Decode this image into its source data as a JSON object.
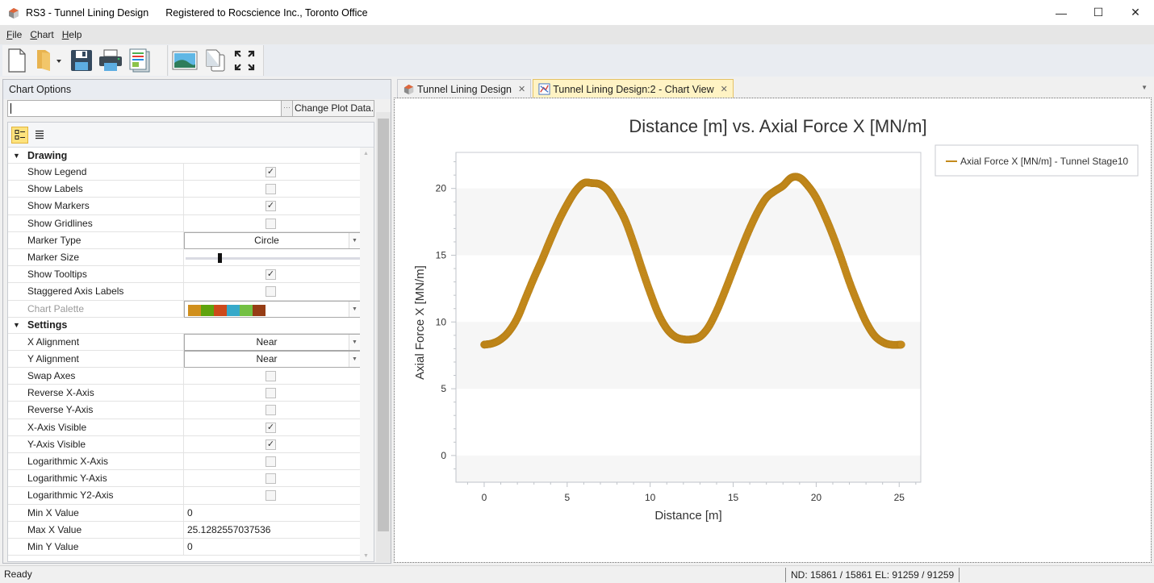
{
  "window": {
    "title": "RS3 - Tunnel Lining Design",
    "registration": "Registered to Rocscience Inc., Toronto Office",
    "minimize": "—",
    "maximize": "☐",
    "close": "✕"
  },
  "menu": [
    {
      "label": "File",
      "accel": "F",
      "rest": "ile"
    },
    {
      "label": "Chart",
      "accel": "C",
      "rest": "hart"
    },
    {
      "label": "Help",
      "accel": "H",
      "rest": "elp"
    }
  ],
  "toolbar": {
    "icons": [
      "new-document-icon",
      "open-folder-icon",
      "save-icon",
      "print-icon",
      "report-icon",
      "export-image-icon",
      "copy-icon",
      "fullscreen-icon"
    ]
  },
  "chart_options": {
    "title": "Chart Options",
    "search_value": "",
    "change_plot_data": "Change Plot Data...",
    "dots": "···",
    "categories": [
      {
        "label": "Drawing",
        "rows": [
          {
            "name": "Show Legend",
            "type": "checkbox",
            "checked": true
          },
          {
            "name": "Show Labels",
            "type": "checkbox",
            "checked": false
          },
          {
            "name": "Show Markers",
            "type": "checkbox",
            "checked": true
          },
          {
            "name": "Show Gridlines",
            "type": "checkbox",
            "checked": false
          },
          {
            "name": "Marker Type",
            "type": "combo",
            "value": "Circle"
          },
          {
            "name": "Marker Size",
            "type": "slider",
            "value_fraction": 0.19
          },
          {
            "name": "Show Tooltips",
            "type": "checkbox",
            "checked": true
          },
          {
            "name": "Staggered Axis Labels",
            "type": "checkbox",
            "checked": false
          },
          {
            "name": "Chart Palette",
            "type": "palette",
            "disabled": true,
            "colors": [
              "#d08f1c",
              "#5fa30d",
              "#cd4a1b",
              "#36a9c9",
              "#73c043",
              "#963d15"
            ]
          }
        ]
      },
      {
        "label": "Settings",
        "rows": [
          {
            "name": "X Alignment",
            "type": "combo",
            "value": "Near"
          },
          {
            "name": "Y Alignment",
            "type": "combo",
            "value": "Near"
          },
          {
            "name": "Swap Axes",
            "type": "checkbox",
            "checked": false
          },
          {
            "name": "Reverse X-Axis",
            "type": "checkbox",
            "checked": false
          },
          {
            "name": "Reverse Y-Axis",
            "type": "checkbox",
            "checked": false
          },
          {
            "name": "X-Axis Visible",
            "type": "checkbox",
            "checked": true
          },
          {
            "name": "Y-Axis Visible",
            "type": "checkbox",
            "checked": true
          },
          {
            "name": "Logarithmic X-Axis",
            "type": "checkbox",
            "checked": false
          },
          {
            "name": "Logarithmic Y-Axis",
            "type": "checkbox",
            "checked": false
          },
          {
            "name": "Logarithmic Y2-Axis",
            "type": "checkbox",
            "checked": false
          },
          {
            "name": "Min X Value",
            "type": "text",
            "value": "0"
          },
          {
            "name": "Max X Value",
            "type": "text",
            "value": "25.1282557037536"
          },
          {
            "name": "Min Y Value",
            "type": "text",
            "value": "0"
          }
        ]
      }
    ]
  },
  "tabs": [
    {
      "label": "Tunnel Lining Design",
      "active": false,
      "icon": "model-icon"
    },
    {
      "label": "Tunnel Lining Design:2 - Chart View",
      "active": true,
      "icon": "chart-icon"
    }
  ],
  "tab_close": "✕",
  "status": {
    "ready": "Ready",
    "counts": "ND: 15861 / 15861  EL: 91259 / 91259"
  },
  "chart_data": {
    "type": "scatter",
    "title": "Distance [m] vs. Axial Force X [MN/m]",
    "xlabel": "Distance [m]",
    "ylabel": "Axial Force X [MN/m]",
    "xlim": [
      -1.7,
      26.3
    ],
    "ylim": [
      -2,
      22.7
    ],
    "xticks": [
      0,
      5,
      10,
      15,
      20,
      25
    ],
    "yticks": [
      0,
      5,
      10,
      15,
      20
    ],
    "grid": false,
    "alternating_bands": true,
    "legend_position": "top-right outside",
    "marker": "circle",
    "series": [
      {
        "name": "Axial Force X [MN/m] - Tunnel Stage10",
        "color": "#c48a1c",
        "x": [
          0,
          0.5,
          1,
          1.5,
          2,
          2.5,
          3,
          3.5,
          4,
          4.5,
          5,
          5.5,
          6,
          6.5,
          7,
          7.5,
          8,
          8.5,
          9,
          9.5,
          10,
          10.5,
          11,
          11.5,
          12,
          12.5,
          13,
          13.5,
          14,
          14.5,
          15,
          15.5,
          16,
          16.5,
          17,
          17.5,
          18,
          18.5,
          19,
          19.5,
          20,
          20.5,
          21,
          21.5,
          22,
          22.5,
          23,
          23.5,
          24,
          24.5,
          25.13
        ],
        "y": [
          8.3,
          8.4,
          8.7,
          9.3,
          10.3,
          11.8,
          13.3,
          14.7,
          16.2,
          17.6,
          18.8,
          19.8,
          20.4,
          20.4,
          20.3,
          19.8,
          18.8,
          17.6,
          15.9,
          14.0,
          12.2,
          10.6,
          9.5,
          8.9,
          8.7,
          8.7,
          8.9,
          9.6,
          10.8,
          12.3,
          13.9,
          15.5,
          17.0,
          18.3,
          19.3,
          19.8,
          20.2,
          20.8,
          20.8,
          20.2,
          19.3,
          18.0,
          16.5,
          14.8,
          13.0,
          11.4,
          10.0,
          9.0,
          8.5,
          8.3,
          8.3
        ]
      }
    ]
  }
}
